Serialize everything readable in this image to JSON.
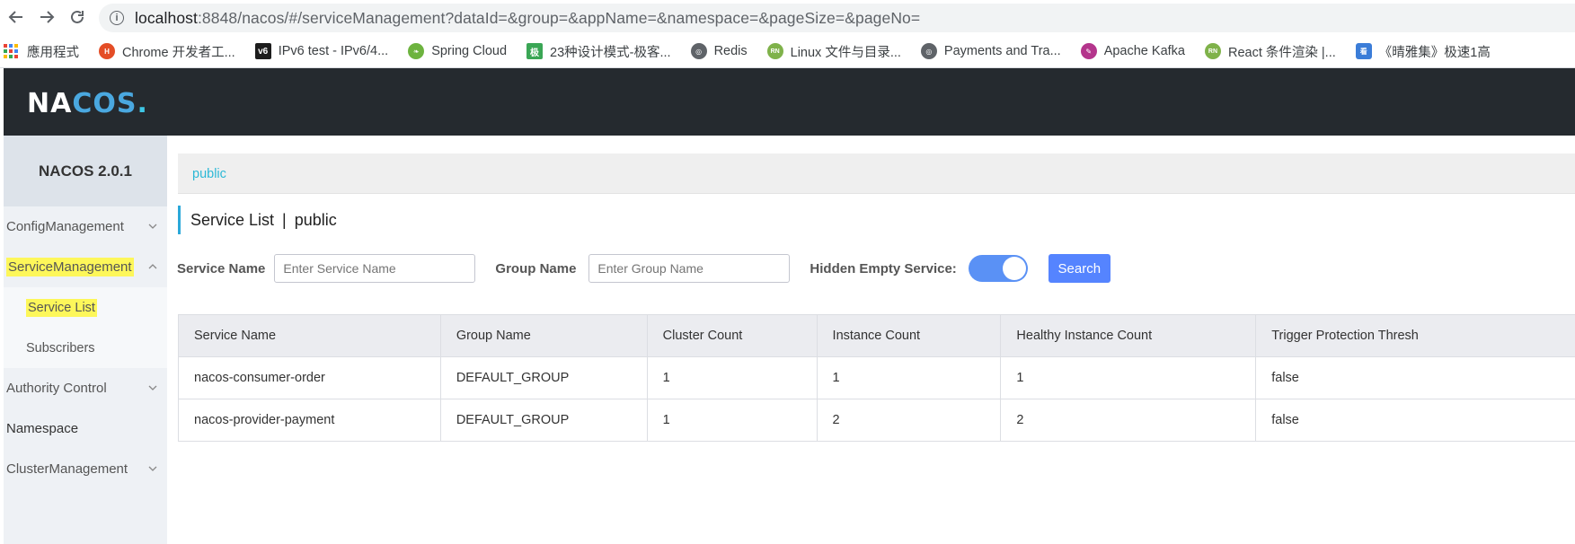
{
  "browser": {
    "url_host": "localhost",
    "url_rest": ":8848/nacos/#/serviceManagement?dataId=&group=&appName=&namespace=&pageSize=&pageNo=",
    "bookmarks": [
      {
        "label": "應用程式",
        "icon": "apps-grid-icon",
        "color": "#4285f4"
      },
      {
        "label": "Chrome 开发者工...",
        "icon": "html-icon",
        "color": "#e44d26"
      },
      {
        "label": "IPv6 test - IPv6/4...",
        "icon": "v6-icon",
        "color": "#1d1d1d"
      },
      {
        "label": "Spring Cloud",
        "icon": "spring-icon",
        "color": "#6db33f"
      },
      {
        "label": "23种设计模式-极客...",
        "icon": "jike-icon",
        "color": "#3aa655"
      },
      {
        "label": "Redis",
        "icon": "globe-icon",
        "color": "#5f6368"
      },
      {
        "label": "Linux 文件与目录...",
        "icon": "runoob-icon",
        "color": "#7fb24a"
      },
      {
        "label": "Payments and Tra...",
        "icon": "globe-icon",
        "color": "#5f6368"
      },
      {
        "label": "Apache Kafka",
        "icon": "kafka-feather-icon",
        "color": "#b4358c"
      },
      {
        "label": "React 条件渲染 |...",
        "icon": "runoob-icon",
        "color": "#7fb24a"
      },
      {
        "label": "《晴雅集》极速1高",
        "icon": "book-icon",
        "color": "#3b7dd8"
      }
    ]
  },
  "header": {
    "logo_pre": "NA",
    "logo_o": "C",
    "logo_post": "OS",
    "logo_dot": "."
  },
  "sidebar": {
    "title": "NACOS 2.0.1",
    "items": [
      {
        "label": "ConfigManagement"
      },
      {
        "label": "ServiceManagement"
      },
      {
        "label": "Service List"
      },
      {
        "label": "Subscribers"
      },
      {
        "label": "Authority Control"
      },
      {
        "label": "Namespace"
      },
      {
        "label": "ClusterManagement"
      }
    ]
  },
  "namespace_bar": {
    "label": "public"
  },
  "heading": {
    "title": "Service List",
    "separator": "|",
    "namespace": "public"
  },
  "filters": {
    "service_name_label": "Service Name",
    "service_name_placeholder": "Enter Service Name",
    "group_name_label": "Group Name",
    "group_name_placeholder": "Enter Group Name",
    "hidden_empty_label": "Hidden Empty Service:",
    "hidden_empty_on": true,
    "search_label": "Search"
  },
  "table": {
    "columns": [
      "Service Name",
      "Group Name",
      "Cluster Count",
      "Instance Count",
      "Healthy Instance Count",
      "Trigger Protection Thresh"
    ],
    "rows": [
      [
        "nacos-consumer-order",
        "DEFAULT_GROUP",
        "1",
        "1",
        "1",
        "false"
      ],
      [
        "nacos-provider-payment",
        "DEFAULT_GROUP",
        "1",
        "2",
        "2",
        "false"
      ]
    ]
  }
}
